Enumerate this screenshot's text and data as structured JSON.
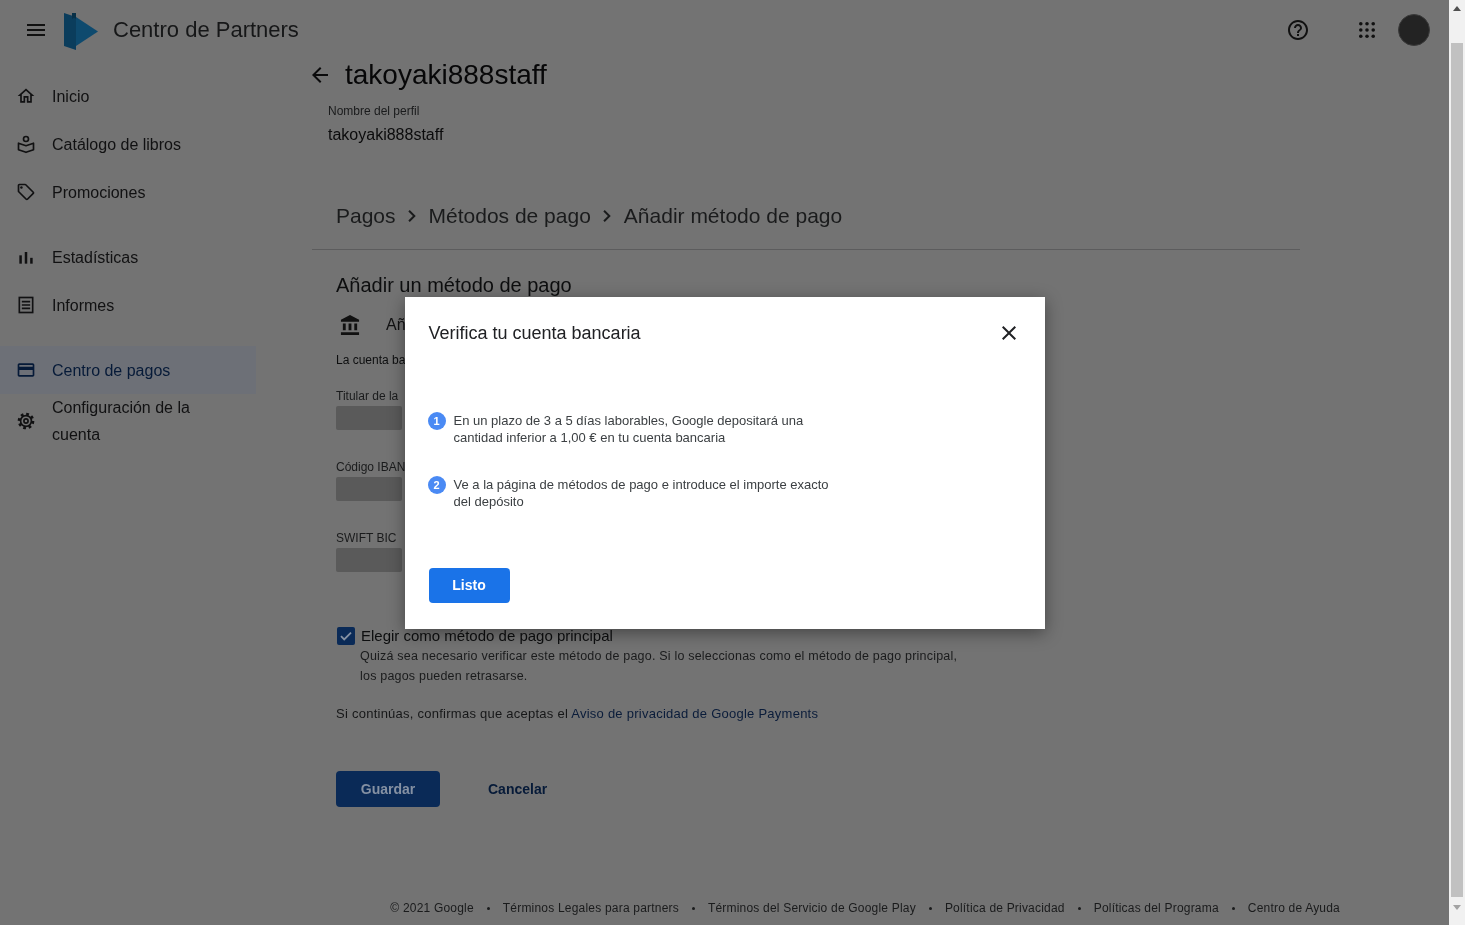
{
  "header": {
    "title": "Centro de Partners"
  },
  "sidebar": {
    "sections": [
      {
        "items": [
          {
            "label": "Inicio",
            "selected": false
          },
          {
            "label": "Catálogo de libros",
            "selected": false
          },
          {
            "label": "Promociones",
            "selected": false
          }
        ]
      },
      {
        "items": [
          {
            "label": "Estadísticas",
            "selected": false
          },
          {
            "label": "Informes",
            "selected": false
          }
        ]
      },
      {
        "items": [
          {
            "label": "Centro de pagos",
            "selected": true
          },
          {
            "label": "Configuración de la cuenta",
            "selected": false
          }
        ]
      }
    ]
  },
  "page": {
    "title": "takoyaki888staff",
    "profile": {
      "label": "Nombre del perfil",
      "value": "takoyaki888staff"
    },
    "breadcrumb": [
      "Pagos",
      "Métodos de pago",
      "Añadir método de pago"
    ],
    "form": {
      "heading": "Añadir un método de pago",
      "method": "Añ",
      "note": "La cuenta ba",
      "fields": [
        {
          "label": "Titular de la"
        },
        {
          "label": "Código IBAN"
        },
        {
          "label": "SWIFT BIC"
        }
      ],
      "primary": {
        "label": "Elegir como método de pago principal",
        "checked": true,
        "hint": "Quizá sea necesario verificar este método de pago. Si lo seleccionas como el método de pago principal, los pagos pueden retrasarse."
      },
      "privacy": {
        "text": "Si continúas, confirmas que aceptas el",
        "link": "Aviso de privacidad de Google Payments"
      },
      "buttons": [
        {
          "label": "Guardar",
          "kind": "primary"
        },
        {
          "label": "Cancelar",
          "kind": "text"
        }
      ]
    }
  },
  "footer": {
    "copyright": "© 2021 Google",
    "links": [
      "Términos Legales para partners",
      "Términos del Servicio de Google Play",
      "Política de Privacidad",
      "Políticas del Programa",
      "Centro de Ayuda"
    ]
  },
  "dialog": {
    "title": "Verifica tu cuenta bancaria",
    "steps": [
      {
        "number": "1",
        "text": "En un plazo de 3 a 5 días laborables, Google depositará una cantidad inferior a 1,00 € en tu cuenta bancaria"
      },
      {
        "number": "2",
        "text": "Ve a la página de métodos de pago e introduce el importe exacto del depósito"
      }
    ],
    "button": "Listo"
  }
}
